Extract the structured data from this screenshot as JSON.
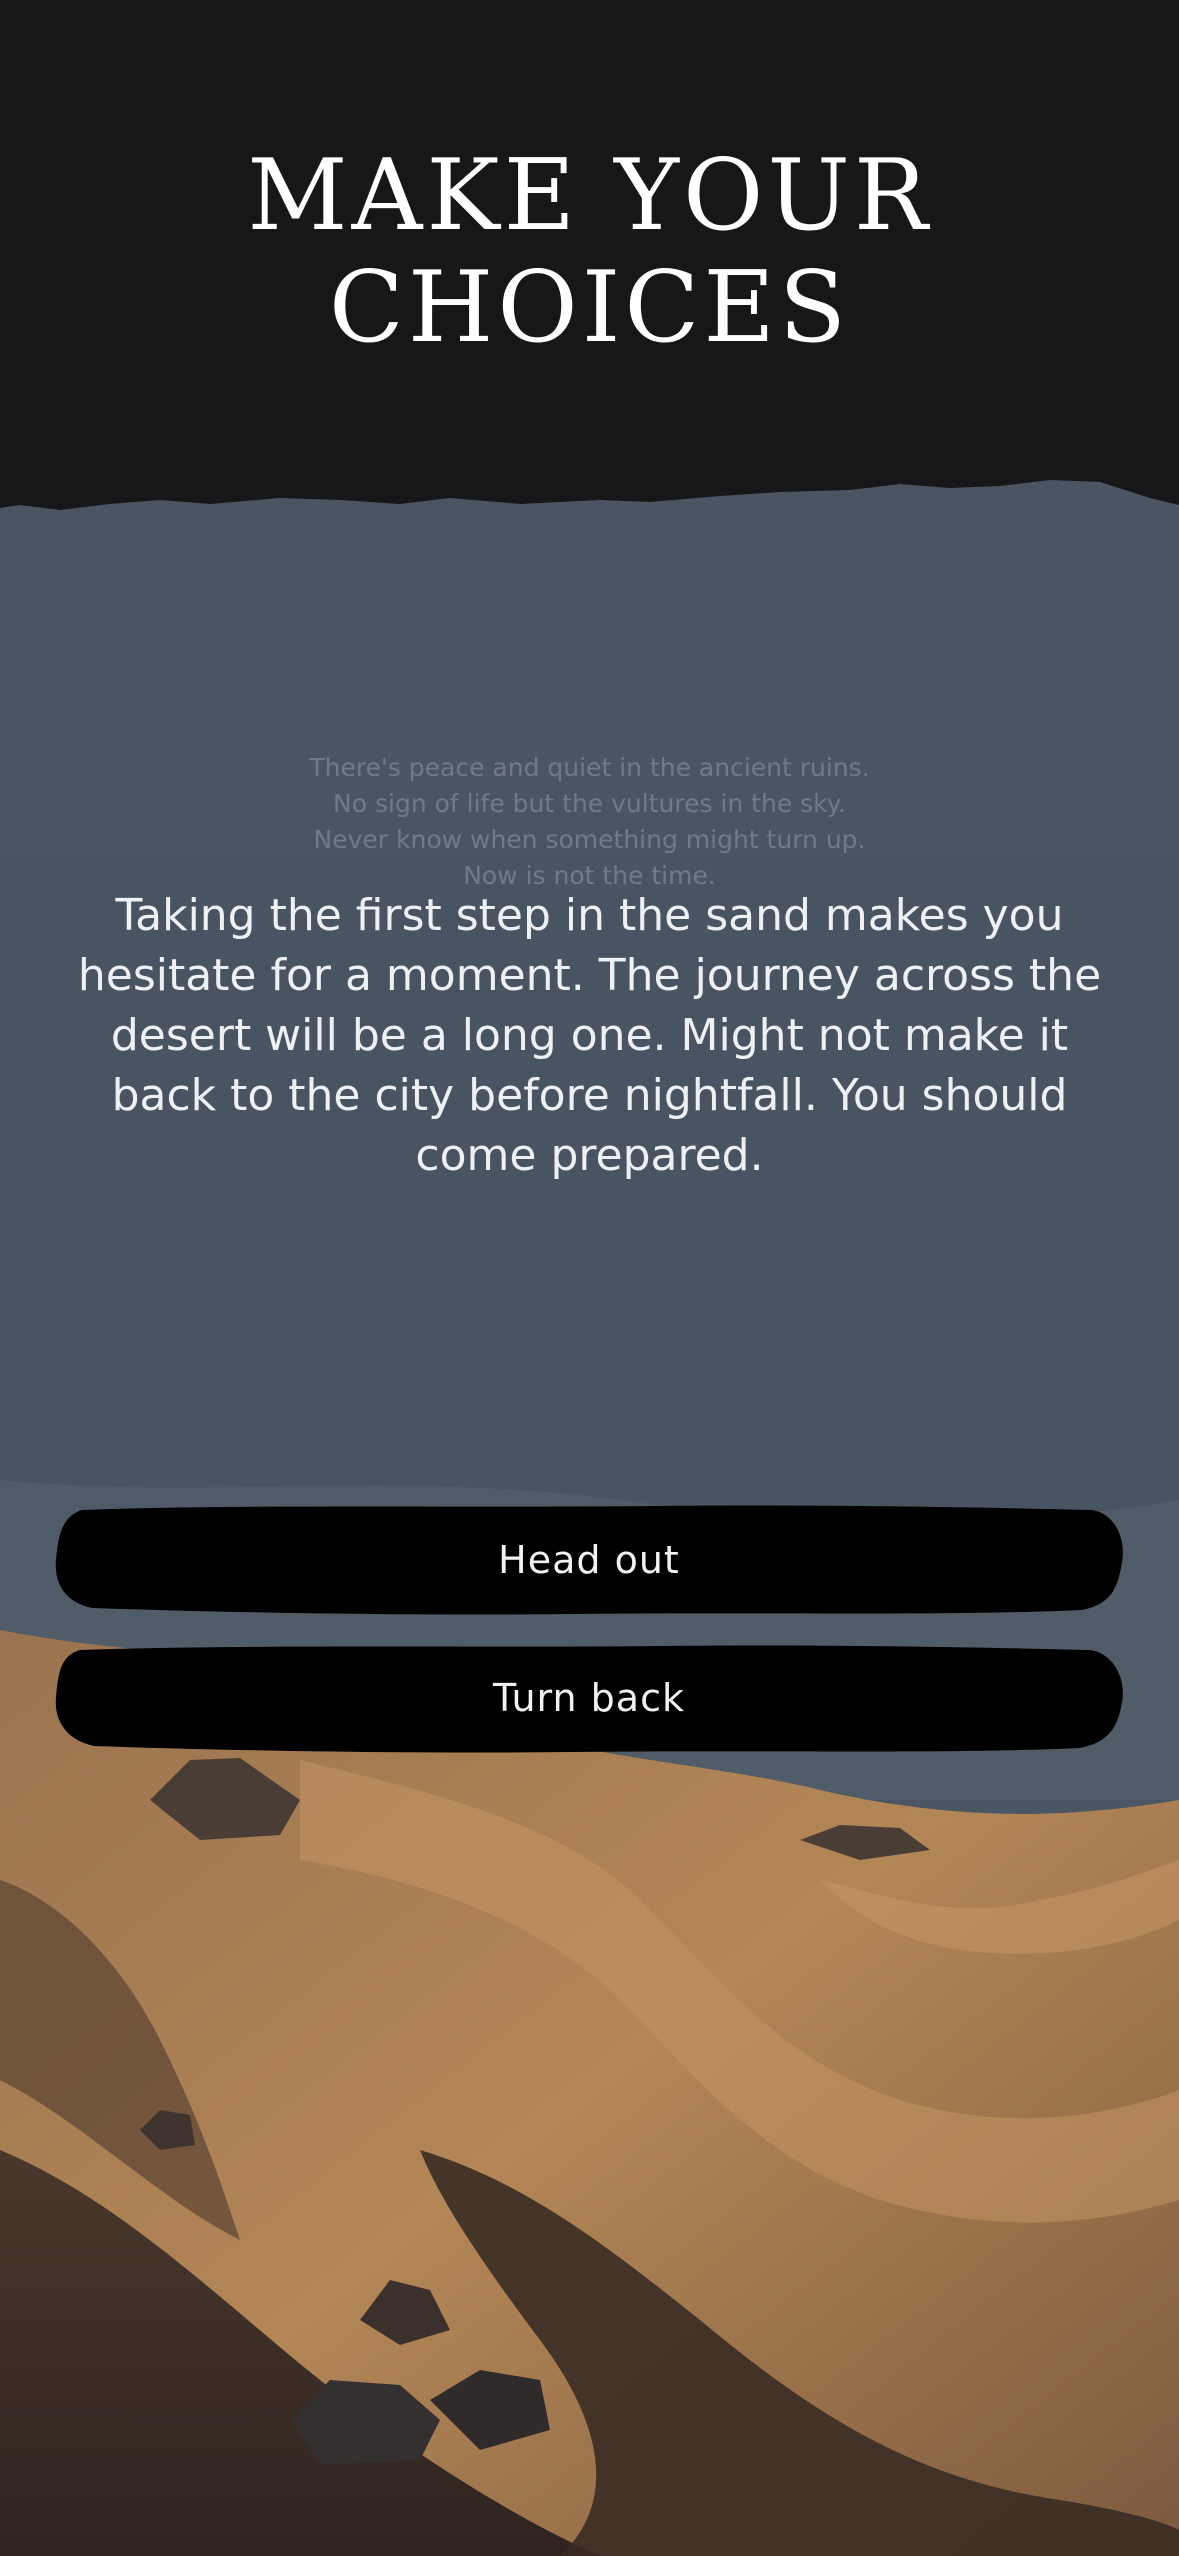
{
  "header": {
    "title_line1": "MAKE YOUR",
    "title_line2": "CHOICES"
  },
  "story": {
    "tiny_lines": [
      "",
      "",
      "",
      ""
    ],
    "faded_lines": [
      "There's peace and quiet in the ancient ruins.",
      "No sign of life but the vultures in the sky.",
      "Never know when something might turn up.",
      "Now is not the time."
    ],
    "current_text": "Taking the first step in the sand makes you hesitate for a moment. The journey across the desert will be a long one. Might not make it back to the city before nightfall. You should come prepared."
  },
  "choices": [
    {
      "label": "Head out"
    },
    {
      "label": "Turn back"
    }
  ],
  "colors": {
    "header_bg": "#17171a",
    "sky": "#4a5563",
    "sand_light": "#b5885a",
    "sand_dark": "#3a2b24",
    "button_bg": "#000000"
  }
}
